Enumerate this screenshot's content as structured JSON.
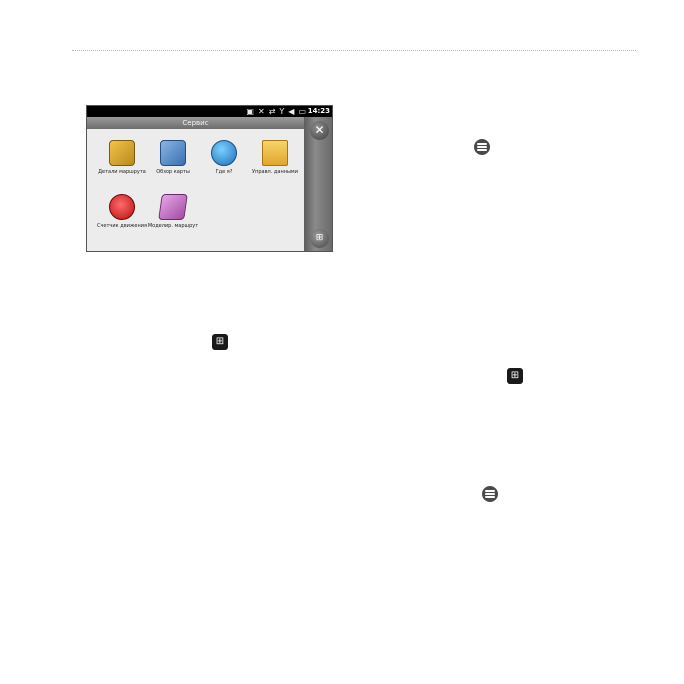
{
  "device": {
    "clock": "14:23",
    "window_title": "Сервис",
    "apps": [
      {
        "label": "Детали маршрута",
        "icon": "route-details-icon"
      },
      {
        "label": "Обзор карты",
        "icon": "map-overview-icon"
      },
      {
        "label": "Где я?",
        "icon": "where-am-i-icon"
      },
      {
        "label": "Управл. данными",
        "icon": "data-manager-icon"
      },
      {
        "label": "Счетчик движения",
        "icon": "trip-computer-icon"
      },
      {
        "label": "Моделир. маршрут",
        "icon": "route-simulator-icon"
      }
    ],
    "close_glyph": "✕",
    "start_glyph": "⊞"
  },
  "page_icons": {
    "menu": "menu-icon",
    "windows": "windows-start-icon",
    "win_glyph": "⊞"
  }
}
